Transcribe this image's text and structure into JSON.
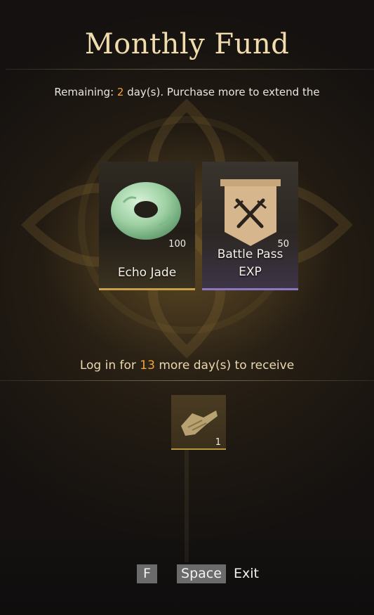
{
  "title": "Monthly Fund",
  "remaining": {
    "prefix": "Remaining: ",
    "days": "2",
    "suffix": " day(s). Purchase more to extend the"
  },
  "rewards": [
    {
      "name": "Echo Jade",
      "quantity": "100",
      "icon": "jade-ring-icon",
      "rarity_color": "#c5a048"
    },
    {
      "name_line1": "Battle Pass",
      "name_line2": "EXP",
      "quantity": "50",
      "icon": "battle-pass-banner-icon",
      "rarity_color": "#8a78c2"
    }
  ],
  "login": {
    "prefix": "Log in for ",
    "days": "13",
    "suffix": " more day(s) to receive"
  },
  "login_reward": {
    "quantity": "1",
    "icon": "weapon-blueprint-icon"
  },
  "controls": {
    "key_f": "F",
    "key_space": "Space",
    "exit_label": "Exit"
  },
  "colors": {
    "accent": "#f0a43a",
    "title": "#f1dcae"
  }
}
